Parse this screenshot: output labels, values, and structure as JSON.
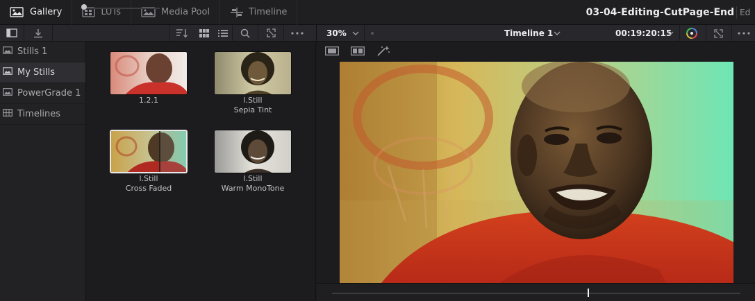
{
  "top_tabs": [
    {
      "label": "Gallery",
      "icon": "gallery-icon",
      "active": true
    },
    {
      "label": "LUTs",
      "icon": "luts-icon",
      "active": false
    },
    {
      "label": "Media Pool",
      "icon": "media-pool-icon",
      "active": false
    },
    {
      "label": "Timeline",
      "icon": "timeline-icon",
      "active": false
    }
  ],
  "project": {
    "title": "03-04-Editing-CutPage-End",
    "extra": "Ed"
  },
  "gallery_toolbar": {
    "icons": [
      "sidebar-toggle-icon",
      "import-icon",
      "sort-icon",
      "grid-view-icon",
      "list-view-icon",
      "search-icon",
      "expand-icon",
      "more-options-icon"
    ],
    "thumb_size_level": 0.0
  },
  "sidebar": {
    "items": [
      {
        "label": "Stills 1",
        "icon": "stills-album-icon",
        "active": false
      },
      {
        "label": "My Stills",
        "icon": "stills-album-icon",
        "active": true
      },
      {
        "label": "PowerGrade 1",
        "icon": "powergrade-icon",
        "active": false
      },
      {
        "label": "Timelines",
        "icon": "timelines-album-icon",
        "active": false
      }
    ]
  },
  "stills": [
    {
      "line1": "1.2.1",
      "line2": "",
      "look": "natural",
      "selected": false
    },
    {
      "line1": "l.Still",
      "line2": "Sepia Tint",
      "look": "sepia",
      "selected": false
    },
    {
      "line1": "l.Still",
      "line2": "Cross Faded",
      "look": "split",
      "selected": true
    },
    {
      "line1": "l.Still",
      "line2": "Warm MonoTone",
      "look": "warm",
      "selected": false
    }
  ],
  "viewer_toolbar": {
    "zoom": "30%",
    "timeline_name": "Timeline 1",
    "timecode": "00:19:20:15"
  },
  "viewer_tools": [
    "single-view-icon",
    "split-view-icon",
    "magic-wand-icon"
  ],
  "scrubber": {
    "playhead_fraction": 0.628
  },
  "colors": {
    "accent": "#ededf0",
    "panel": "#222225",
    "background": "#1b1b1e"
  }
}
